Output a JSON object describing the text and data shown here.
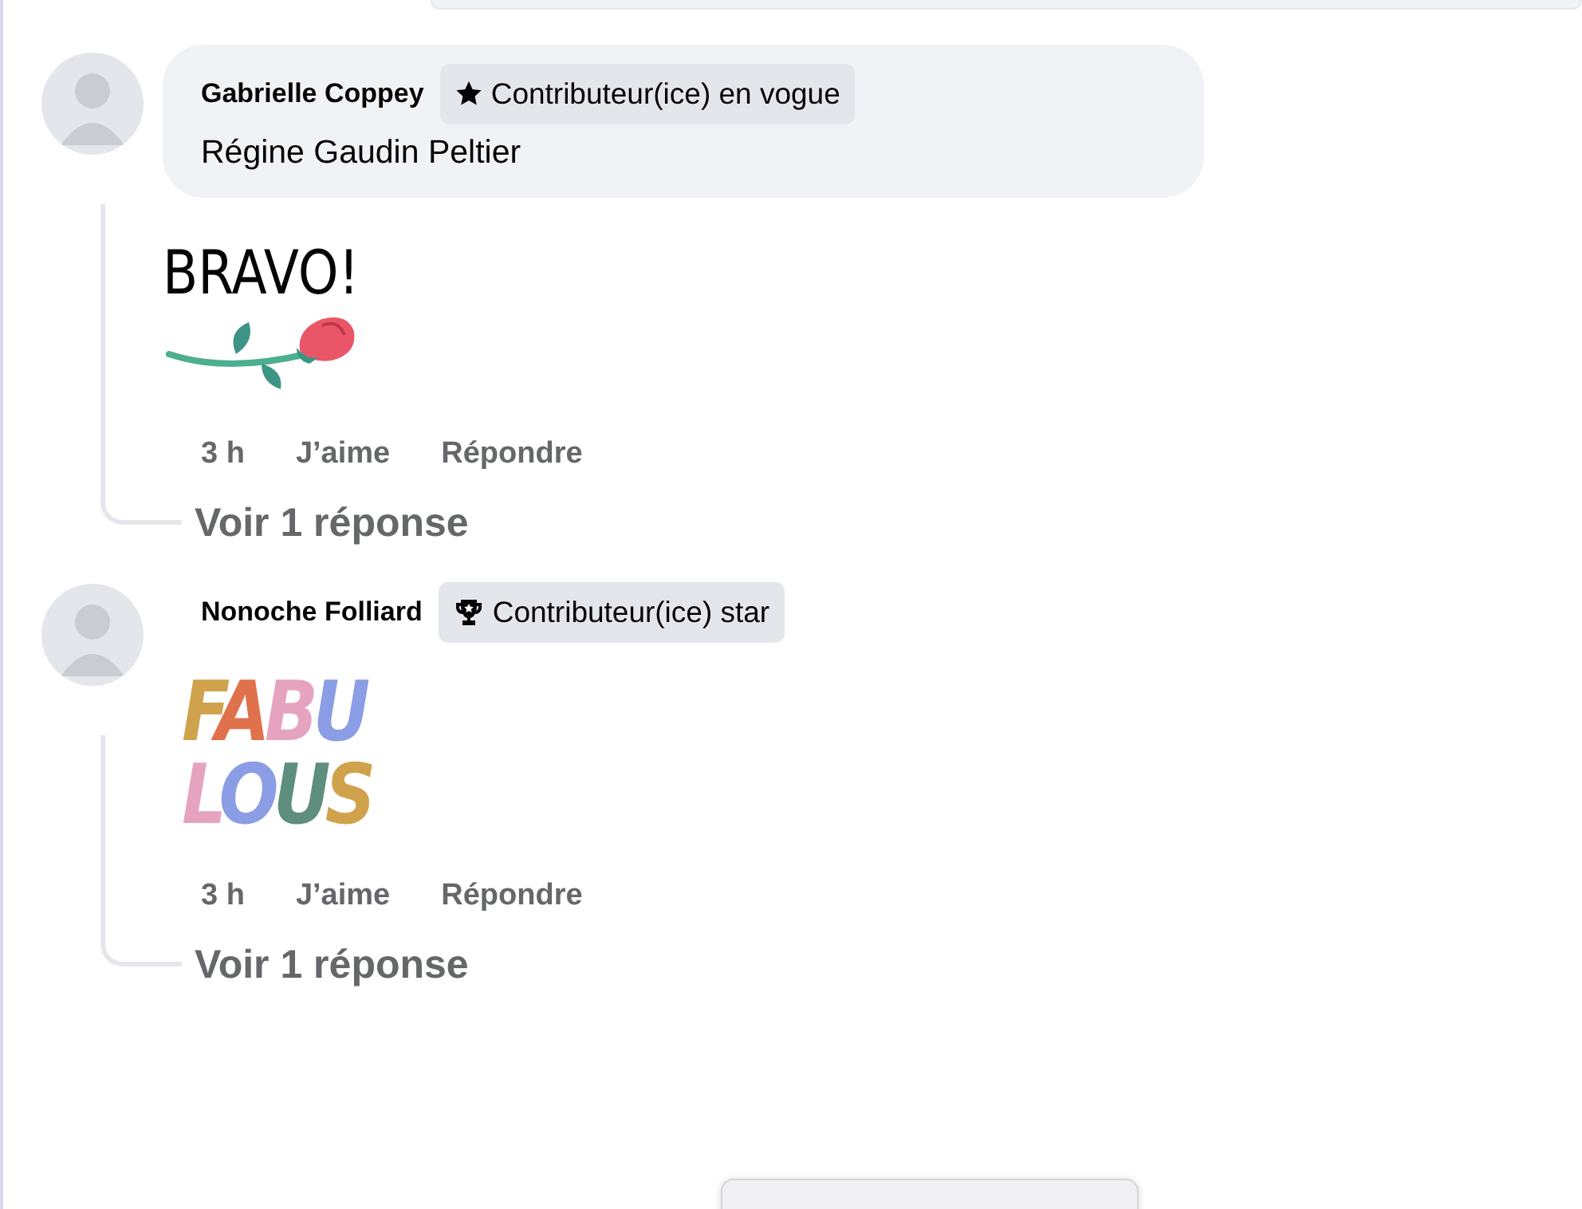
{
  "comments": [
    {
      "author": "Gabrielle Coppey",
      "badge": {
        "kind": "rising",
        "label": "Contributeur(ice) en vogue"
      },
      "text": "Régine Gaudin Peltier",
      "sticker": {
        "kind": "bravo",
        "lines": [
          "BRAVO!"
        ]
      },
      "time": "3 h",
      "like": "J’aime",
      "reply": "Répondre",
      "replies_link": "Voir 1 réponse"
    },
    {
      "author": "Nonoche Folliard",
      "badge": {
        "kind": "star",
        "label": "Contributeur(ice) star"
      },
      "sticker": {
        "kind": "fabulous",
        "lines": [
          "FABU",
          "LOUS"
        ]
      },
      "time": "3 h",
      "like": "J’aime",
      "reply": "Répondre",
      "replies_link": "Voir 1 réponse"
    }
  ]
}
